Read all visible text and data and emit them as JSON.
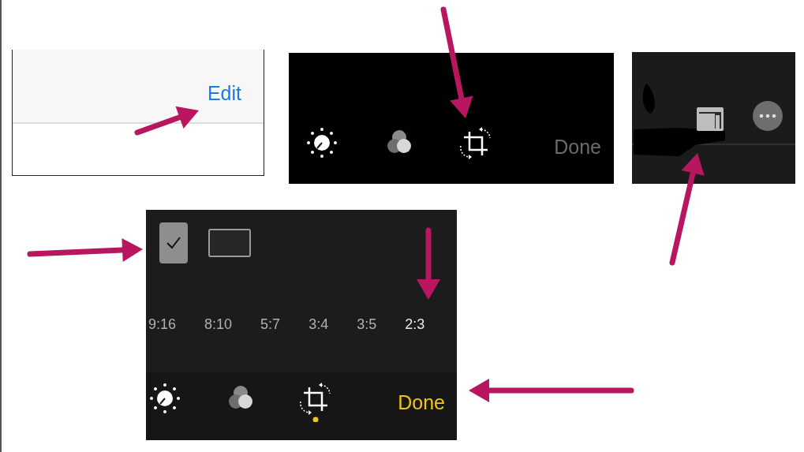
{
  "edit_panel": {
    "edit_button": "Edit"
  },
  "edit_toolbar": {
    "tools": [
      {
        "kind": "adjust",
        "selected": false
      },
      {
        "kind": "filters",
        "selected": false
      },
      {
        "kind": "crop",
        "selected": false
      }
    ],
    "done": {
      "label": "Done",
      "enabled": false
    }
  },
  "crop_panel": {
    "checkbox": {
      "checked": true
    },
    "ratios": [
      {
        "label": "9:16",
        "selected": false
      },
      {
        "label": "8:10",
        "selected": false
      },
      {
        "label": "5:7",
        "selected": false
      },
      {
        "label": "3:4",
        "selected": false
      },
      {
        "label": "3:5",
        "selected": false
      },
      {
        "label": "2:3",
        "selected": true
      }
    ],
    "tools": [
      {
        "kind": "adjust",
        "selected": false
      },
      {
        "kind": "filters",
        "selected": false
      },
      {
        "kind": "crop",
        "selected": true
      }
    ],
    "done": {
      "label": "Done",
      "enabled": true
    }
  }
}
